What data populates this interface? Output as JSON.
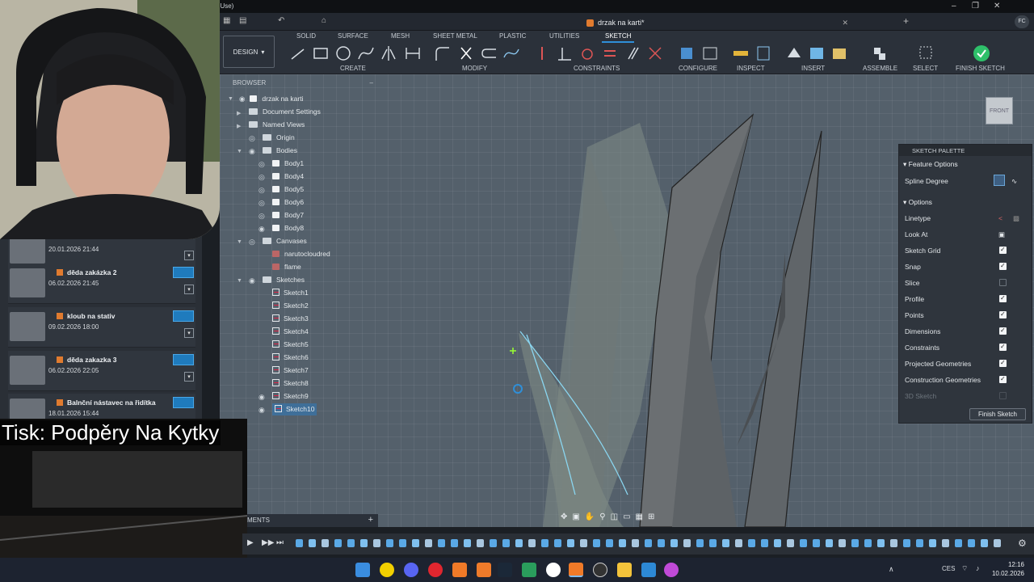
{
  "window": {
    "title_fragment": "al Use)"
  },
  "document_tab": {
    "title": "drzak na karti*"
  },
  "toolbar": {
    "workspace": "DESIGN",
    "tabs": [
      "SOLID",
      "SURFACE",
      "MESH",
      "SHEET METAL",
      "PLASTIC",
      "UTILITIES",
      "SKETCH"
    ],
    "active_tab": "SKETCH",
    "groups": [
      "CREATE",
      "MODIFY",
      "CONSTRAINTS",
      "CONFIGURE",
      "INSPECT",
      "INSERT",
      "ASSEMBLE",
      "SELECT",
      "FINISH SKETCH"
    ]
  },
  "browser": {
    "header": "BROWSER",
    "root": "drzak na karti",
    "items": [
      "Document Settings",
      "Named Views",
      "Origin",
      "Bodies",
      "Body1",
      "Body4",
      "Body5",
      "Body6",
      "Body7",
      "Body8",
      "Canvases",
      "narutocloudred",
      "flame",
      "Sketches",
      "Sketch1",
      "Sketch2",
      "Sketch3",
      "Sketch4",
      "Sketch5",
      "Sketch6",
      "Sketch7",
      "Sketch8",
      "Sketch9",
      "Sketch10"
    ]
  },
  "recent_files": [
    {
      "name": "",
      "date": "20.01.2026 21:44"
    },
    {
      "name": "děda zakázka 2",
      "date": "06.02.2026 21:45"
    },
    {
      "name": "kloub na stativ",
      "date": "09.02.2026 18:00"
    },
    {
      "name": "děda zakazka 3",
      "date": "06.02.2026 22:05"
    },
    {
      "name": "Balnční nástavec na řidítka",
      "date": "18.01.2026 15:44"
    }
  ],
  "overlay": {
    "title": "Tisk: Podpěry Na Kytky"
  },
  "comments": {
    "label": "MENTS"
  },
  "sketch_palette": {
    "header": "SKETCH PALETTE",
    "feature_options": "Feature Options",
    "spline_degree": "Spline Degree",
    "options": "Options",
    "rows": [
      {
        "label": "Linetype",
        "state": "icon"
      },
      {
        "label": "Look At",
        "state": "icon"
      },
      {
        "label": "Sketch Grid",
        "state": "on"
      },
      {
        "label": "Snap",
        "state": "on"
      },
      {
        "label": "Slice",
        "state": "off"
      },
      {
        "label": "Profile",
        "state": "on"
      },
      {
        "label": "Points",
        "state": "on"
      },
      {
        "label": "Dimensions",
        "state": "on"
      },
      {
        "label": "Constraints",
        "state": "on"
      },
      {
        "label": "Projected Geometries",
        "state": "on"
      },
      {
        "label": "Construction Geometries",
        "state": "on"
      },
      {
        "label": "3D Sketch",
        "state": "disabled"
      }
    ],
    "finish_button": "Finish Sketch"
  },
  "viewcube": {
    "face": "FRONT"
  },
  "taskbar": {
    "language": "CES",
    "time": "12:16",
    "date": "10.02.2026"
  }
}
